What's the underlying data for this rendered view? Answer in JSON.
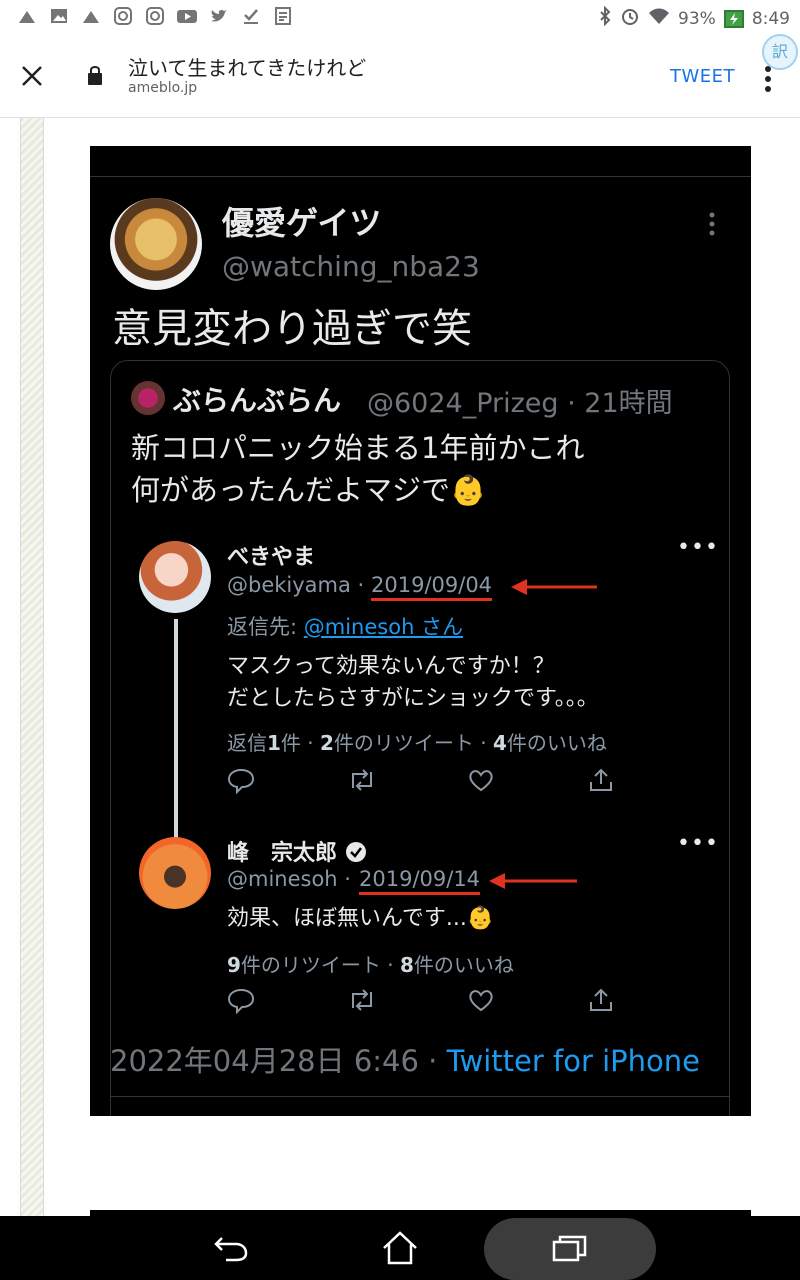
{
  "status_bar": {
    "battery": "93%",
    "time": "8:49",
    "left_icons": [
      "notification-icon",
      "image-icon",
      "notification-icon",
      "instagram-icon",
      "instagram-icon",
      "youtube-icon",
      "twitter-icon",
      "download-icon",
      "article-icon"
    ],
    "right_icons": [
      "bluetooth-icon",
      "alarm-icon",
      "wifi-icon",
      "battery-icon"
    ]
  },
  "app_bar": {
    "title": "泣いて生まれてきたけれど",
    "domain": "ameblo.jp",
    "action_label": "TWEET",
    "translate_glyph": "訳"
  },
  "tweet": {
    "author_name": "優愛ゲイツ",
    "author_handle": "@watching_nba23",
    "text": "意見変わり過ぎで笑",
    "quote": {
      "name": "ぶらんぶらん",
      "meta": "@6024_Prizeg · 21時間",
      "text_line1": "新コロパニック始まる1年前かこれ",
      "text_line2": "何があったんだよマジで👶"
    },
    "thread": [
      {
        "name": "べきやま",
        "handle": "@bekiyama ·",
        "date": "2019/09/04",
        "reply_prefix": "返信先: ",
        "reply_to": "@minesoh さん",
        "text_line1": "マスクって効果ないんですか！？",
        "text_line2": "だとしたらさすがにショックです。。。",
        "stats": {
          "replies_prefix": "返信",
          "replies": "1",
          "replies_suffix": "件 ·",
          "retweets": "2",
          "retweets_suffix": "件のリツイート ·",
          "likes": "4",
          "likes_suffix": "件のいいね"
        }
      },
      {
        "name": "峰　宗太郎",
        "handle": "@minesoh ·",
        "date": "2019/09/14",
        "text_line1": "効果、ほぼ無いんです...👶",
        "stats": {
          "retweets": "9",
          "retweets_suffix": "件のリツイート ·",
          "likes": "8",
          "likes_suffix": "件のいいね"
        }
      }
    ],
    "timestamp": "2022年04月28日 6:46 ·",
    "source": "Twitter for iPhone"
  },
  "colors": {
    "accent_blue": "#1d9bf0",
    "annotation_red": "#e0321f",
    "tweet_background": "#000000"
  }
}
